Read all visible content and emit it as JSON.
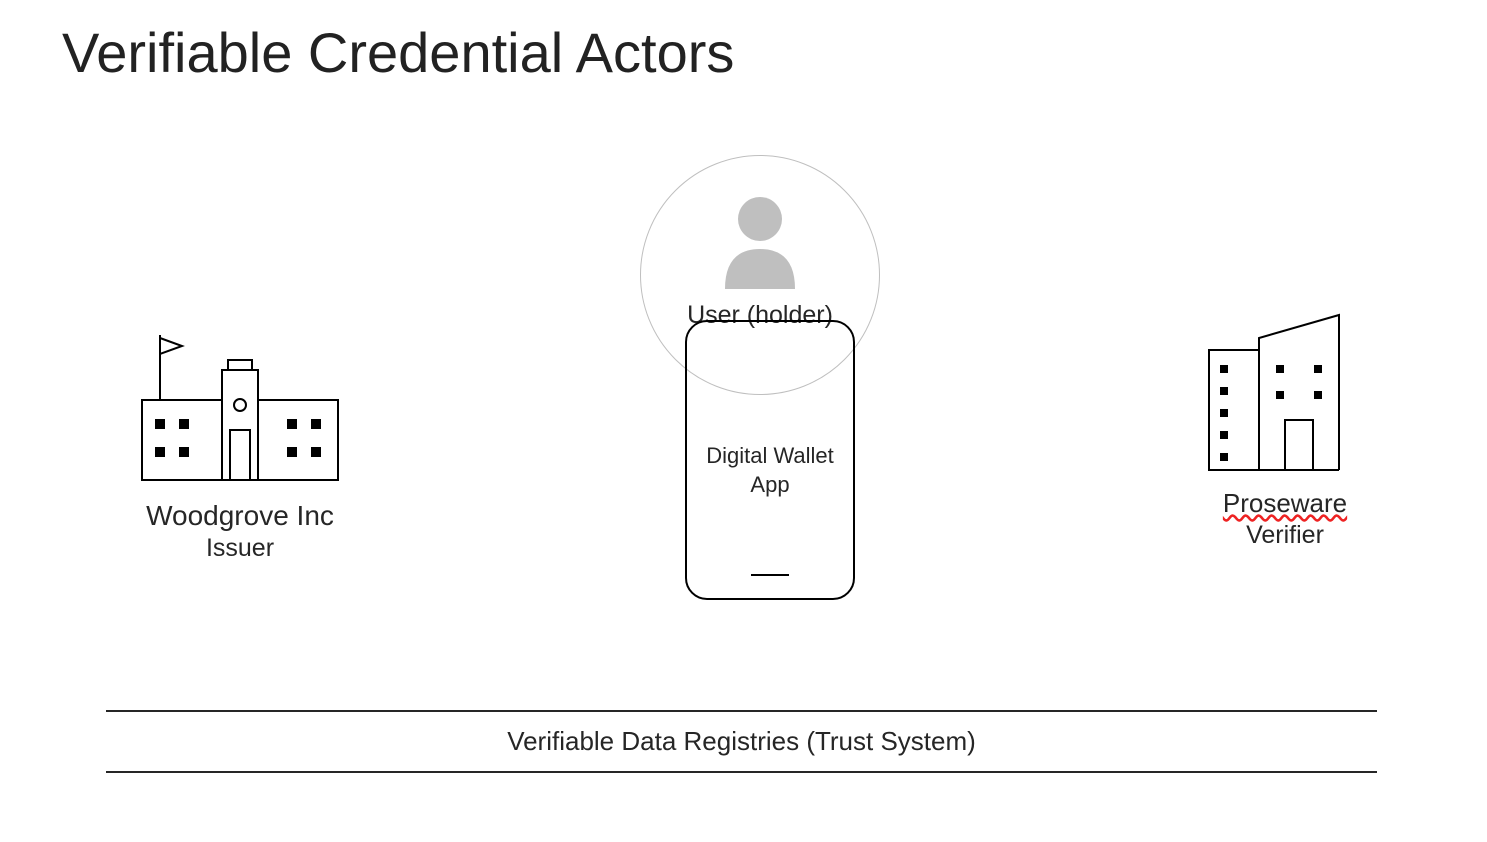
{
  "title": "Verifiable Credential Actors",
  "issuer": {
    "company": "Woodgrove Inc",
    "role": "Issuer"
  },
  "holder": {
    "user_label": "User (holder)",
    "wallet_line1": "Digital Wallet",
    "wallet_line2": "App"
  },
  "verifier": {
    "company": "Proseware",
    "role": "Verifier"
  },
  "registry": {
    "label": "Verifiable Data Registries (Trust System)"
  }
}
